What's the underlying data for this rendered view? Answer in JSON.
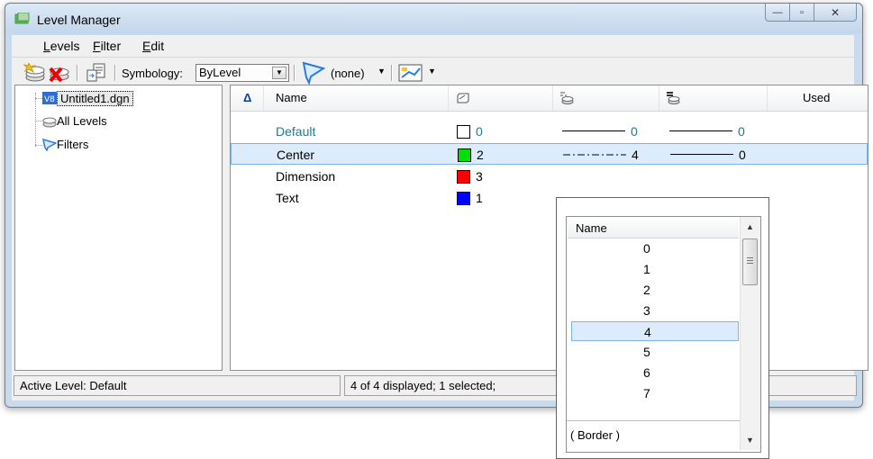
{
  "window": {
    "title": "Level Manager",
    "controls": {
      "minimize": "—",
      "maximize": "▫",
      "close": "✕"
    }
  },
  "menu": [
    {
      "label": "Levels",
      "ukey": "L",
      "rest": "evels"
    },
    {
      "label": "Filter",
      "ukey": "F",
      "rest": "ilter"
    },
    {
      "label": "Edit",
      "ukey": "E",
      "rest": "dit"
    }
  ],
  "toolbar": {
    "symbology_label": "Symbology:",
    "symbology_value": "ByLevel",
    "filter_value": "(none)",
    "icons": [
      "new-level-icon",
      "delete-level-icon",
      "import-icon",
      "filter-icon",
      "display-icon"
    ]
  },
  "tree": {
    "items": [
      {
        "label": "Untitled1.dgn",
        "icon": "dgn-file-icon",
        "selected": true
      },
      {
        "label": "All Levels",
        "icon": "levels-stack-icon",
        "selected": false
      },
      {
        "label": "Filters",
        "icon": "filter-icon",
        "selected": false
      }
    ]
  },
  "list": {
    "sort_indicator": "Δ",
    "columns": {
      "name": "Name",
      "used": "Used",
      "color_icon": "color-column-icon",
      "style_icon": "style-column-icon",
      "weight_icon": "weight-column-icon"
    },
    "rows": [
      {
        "name": "Default",
        "color": "#ffffff",
        "color_num": "0",
        "style_num": "0",
        "weight_num": "0",
        "style": "solid",
        "selected": false,
        "accent": true
      },
      {
        "name": "Center",
        "color": "#00e000",
        "color_num": "2",
        "style_num": "4",
        "weight_num": "0",
        "style": "dash-dot",
        "selected": true,
        "accent": false
      },
      {
        "name": "Dimension",
        "color": "#ff0000",
        "color_num": "3",
        "style_num": "",
        "weight_num": "",
        "style": "none",
        "selected": false,
        "accent": false
      },
      {
        "name": "Text",
        "color": "#0000ff",
        "color_num": "1",
        "style_num": "",
        "weight_num": "",
        "style": "none",
        "selected": false,
        "accent": false
      }
    ]
  },
  "status": {
    "active_level": "Active Level: Default",
    "displayed": "4 of 4 displayed; 1 selected;"
  },
  "popup": {
    "header": "Name",
    "items": [
      {
        "num": "0",
        "style": "solid"
      },
      {
        "num": "1",
        "style": "dotted"
      },
      {
        "num": "2",
        "style": "dashed"
      },
      {
        "num": "3",
        "style": "long-dash"
      },
      {
        "num": "4",
        "style": "dash-dot",
        "selected": true
      },
      {
        "num": "5",
        "style": "short-dash"
      },
      {
        "num": "6",
        "style": "dash-dot-dot"
      },
      {
        "num": "7",
        "style": "dash-long"
      }
    ],
    "border_label": "( Border )"
  },
  "colors": {
    "accent_text": "#1f7a8c",
    "selection": "#dcecfc",
    "selection_border": "#7eb4ea"
  }
}
